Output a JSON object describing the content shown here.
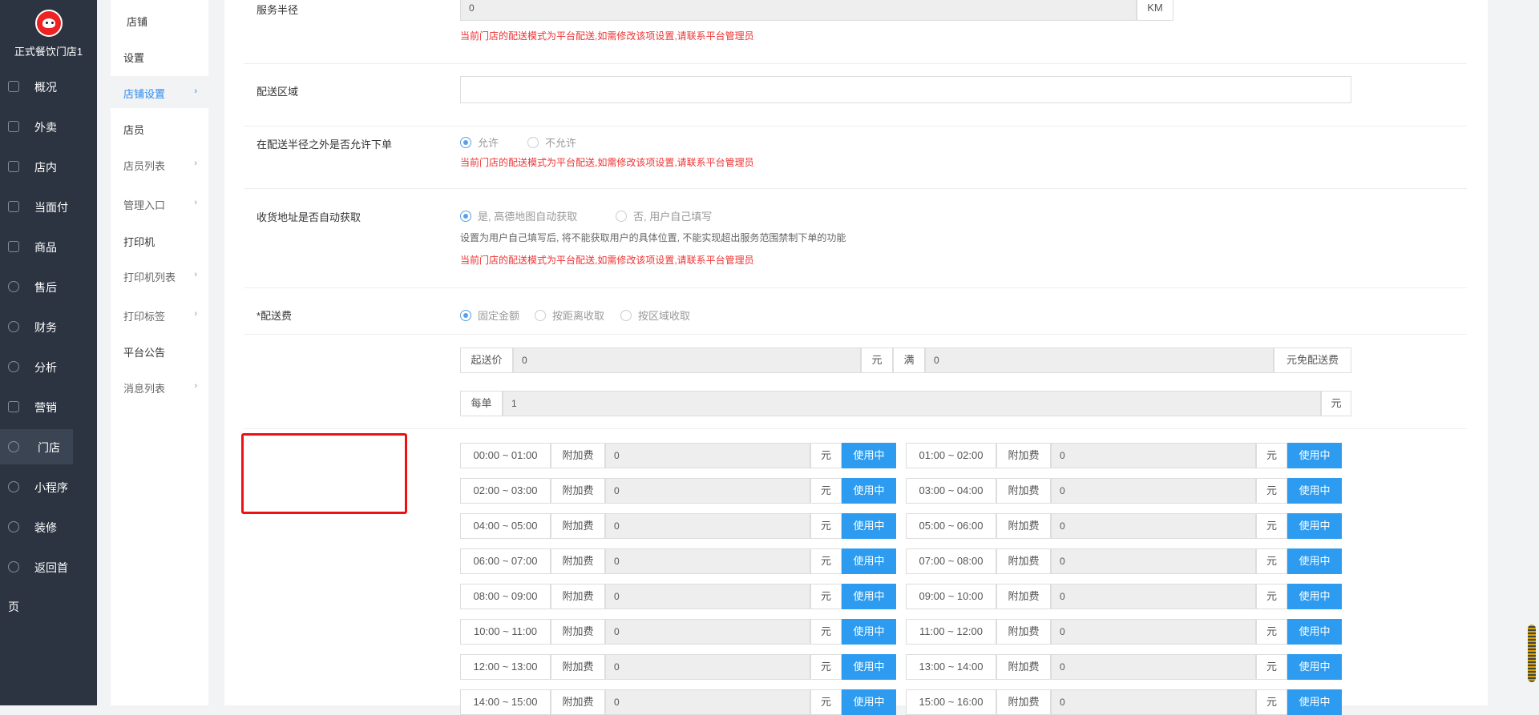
{
  "sidebar": {
    "brand_name": "正式餐饮门店1",
    "items": [
      {
        "label": "概况",
        "icon": "overview-icon"
      },
      {
        "label": "外卖",
        "icon": "delivery-icon"
      },
      {
        "label": "店内",
        "icon": "store-icon"
      },
      {
        "label": "当面付",
        "icon": "payment-icon"
      },
      {
        "label": "商品",
        "icon": "goods-icon"
      },
      {
        "label": "售后",
        "icon": "after-sale-icon"
      },
      {
        "label": "财务",
        "icon": "finance-icon"
      },
      {
        "label": "分析",
        "icon": "analysis-icon"
      },
      {
        "label": "营销",
        "icon": "marketing-icon"
      },
      {
        "label": "门店",
        "icon": "gear-icon",
        "active": true
      },
      {
        "label": "小程序",
        "icon": "gear-icon"
      },
      {
        "label": "装修",
        "icon": "gear-icon"
      },
      {
        "label": "返回首",
        "icon": "gear-icon"
      }
    ],
    "wrap_text": "页"
  },
  "subnav": {
    "items": [
      {
        "label": "店铺",
        "header": true
      },
      {
        "label": "设置"
      },
      {
        "label": "店铺设置",
        "selected": true,
        "chevron": "›"
      },
      {
        "label": "店员"
      },
      {
        "label": "店员列表",
        "chevron": "›"
      },
      {
        "label": "管理入口",
        "chevron": "›"
      },
      {
        "label": "打印机"
      },
      {
        "label": "打印机列表",
        "chevron": "›"
      },
      {
        "label": "打印标签",
        "chevron": "›"
      },
      {
        "label": "平台公告"
      },
      {
        "label": "消息列表",
        "chevron": "›"
      }
    ]
  },
  "form": {
    "radius": {
      "label": "服务半径",
      "value": "0",
      "unit": "KM",
      "tip": "当前门店的配送模式为平台配送,如需修改该项设置,请联系平台管理员"
    },
    "area": {
      "label": "配送区域",
      "value": ""
    },
    "outside": {
      "label": "在配送半径之外是否允许下单",
      "options": [
        "允许",
        "不允许"
      ],
      "selected": 0,
      "tip": "当前门店的配送模式为平台配送,如需修改该项设置,请联系平台管理员"
    },
    "address": {
      "label": "收货地址是否自动获取",
      "options": [
        "是, 高德地图自动获取",
        "否, 用户自己填写"
      ],
      "selected": 0,
      "hint": "设置为用户自己填写后, 将不能获取用户的具体位置, 不能实现超出服务范围禁制下单的功能",
      "tip": "当前门店的配送模式为平台配送,如需修改该项设置,请联系平台管理员"
    },
    "fee": {
      "label": "*配送费",
      "options": [
        "固定金额",
        "按距离收取",
        "按区域收取"
      ],
      "selected": 0
    },
    "min_order": {
      "prefix": "起送价",
      "value": "0",
      "unit": "元",
      "full": "满",
      "free_value": "0",
      "free_suffix": "元免配送费"
    },
    "per_order": {
      "prefix": "每单",
      "value": "1",
      "unit": "元"
    },
    "slot_addon": "附加费",
    "slot_unit": "元",
    "slot_button": "使用中",
    "slots": [
      {
        "time": "00:00 ~ 01:00",
        "value": "0"
      },
      {
        "time": "01:00 ~ 02:00",
        "value": "0"
      },
      {
        "time": "02:00 ~ 03:00",
        "value": "0"
      },
      {
        "time": "03:00 ~ 04:00",
        "value": "0"
      },
      {
        "time": "04:00 ~ 05:00",
        "value": "0"
      },
      {
        "time": "05:00 ~ 06:00",
        "value": "0"
      },
      {
        "time": "06:00 ~ 07:00",
        "value": "0"
      },
      {
        "time": "07:00 ~ 08:00",
        "value": "0"
      },
      {
        "time": "08:00 ~ 09:00",
        "value": "0"
      },
      {
        "time": "09:00 ~ 10:00",
        "value": "0"
      },
      {
        "time": "10:00 ~ 11:00",
        "value": "0"
      },
      {
        "time": "11:00 ~ 12:00",
        "value": "0"
      },
      {
        "time": "12:00 ~ 13:00",
        "value": "0"
      },
      {
        "time": "13:00 ~ 14:00",
        "value": "0"
      },
      {
        "time": "14:00 ~ 15:00",
        "value": "0"
      },
      {
        "time": "15:00 ~ 16:00",
        "value": "0"
      }
    ]
  },
  "colors": {
    "accent": "#2d9cf0",
    "warning_text": "#e33333",
    "sidebar_bg": "#2c3441",
    "highlight_box": "#e11111"
  }
}
